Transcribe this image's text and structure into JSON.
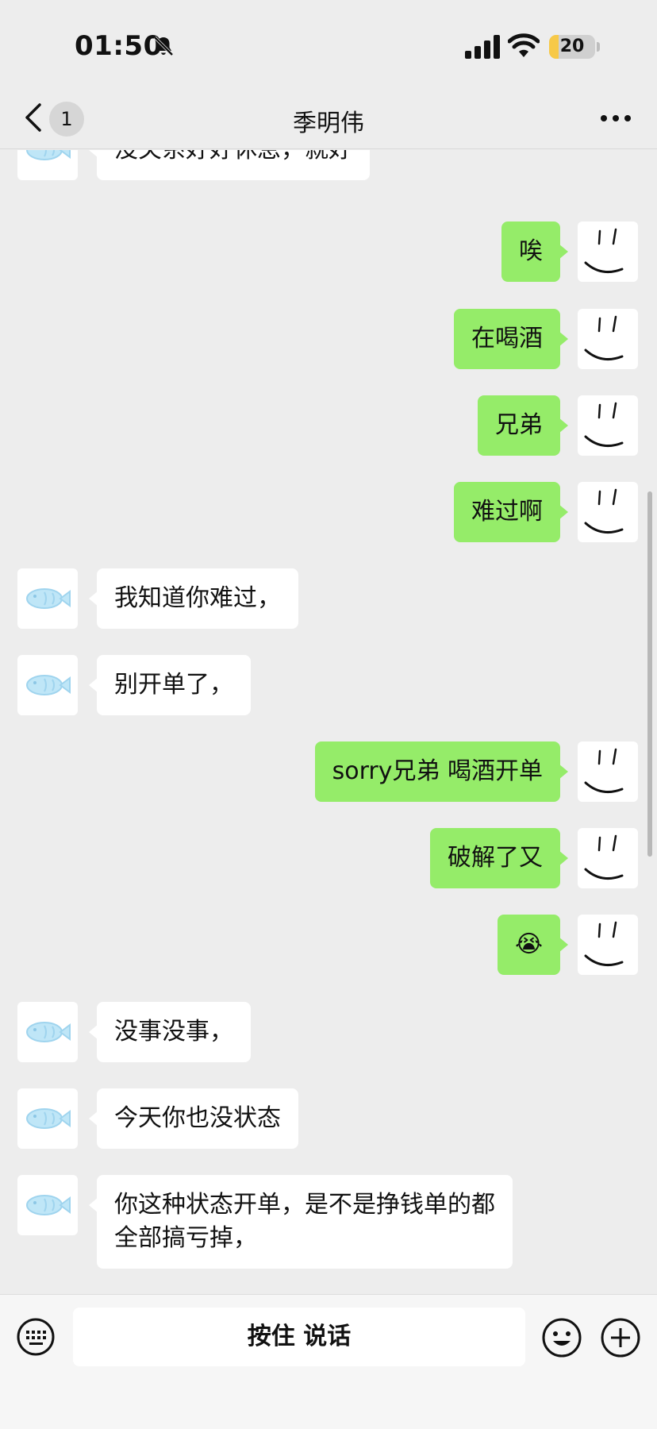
{
  "status_bar": {
    "time": "01:50",
    "battery_level": "20",
    "icons": [
      "bell-mute-icon",
      "signal-icon",
      "wifi-icon",
      "battery-icon"
    ]
  },
  "nav": {
    "unread_count": "1",
    "title": "季明伟",
    "back_icon": "chevron-left-icon",
    "more_icon": "more-dots-icon"
  },
  "messages": [
    {
      "side": "in",
      "text": "没关系好好休息，就好"
    },
    {
      "side": "out",
      "text": "唉"
    },
    {
      "side": "out",
      "text": "在喝酒"
    },
    {
      "side": "out",
      "text": "兄弟"
    },
    {
      "side": "out",
      "text": "难过啊"
    },
    {
      "side": "in",
      "text": "我知道你难过，"
    },
    {
      "side": "in",
      "text": "别开单了，"
    },
    {
      "side": "out",
      "text": "sorry兄弟 喝酒开单"
    },
    {
      "side": "out",
      "text": "破解了又"
    },
    {
      "side": "out",
      "text": "😭"
    },
    {
      "side": "in",
      "text": "没事没事，"
    },
    {
      "side": "in",
      "text": "今天你也没状态"
    },
    {
      "side": "in",
      "text": "你这种状态开单，是不是挣钱单的都\n全部搞亏掉，"
    }
  ],
  "input_bar": {
    "hold_to_talk": "按住 说话",
    "icons": [
      "keyboard-icon",
      "emoji-icon",
      "plus-icon"
    ]
  },
  "colors": {
    "background": "#ededed",
    "outgoing_bubble": "#95ec69",
    "incoming_bubble": "#ffffff",
    "battery": "#f7c948"
  }
}
